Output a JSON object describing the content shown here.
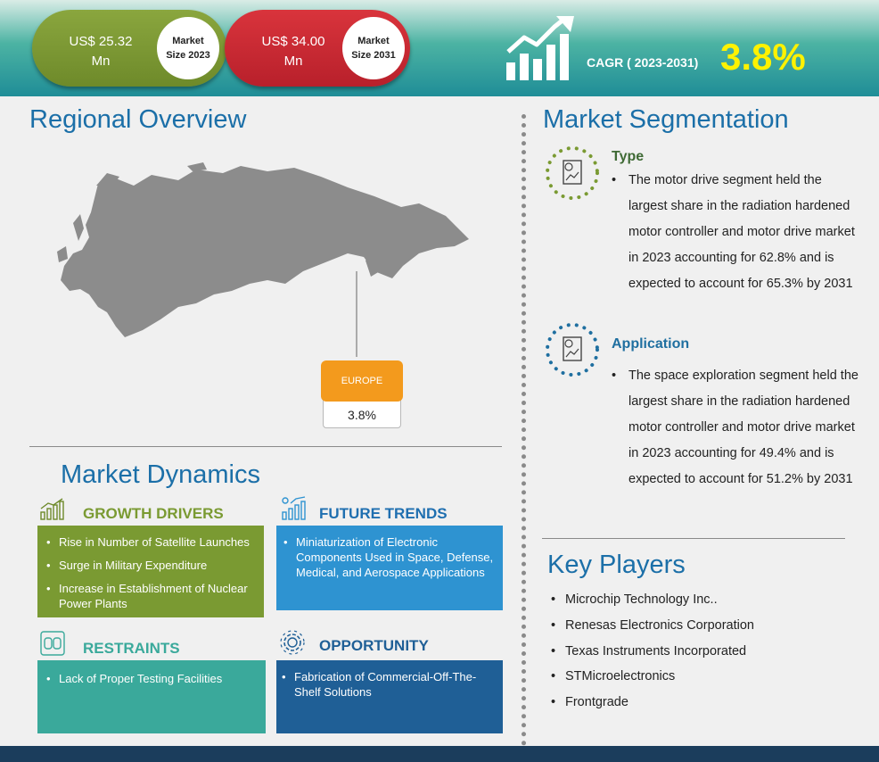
{
  "header": {
    "market_2023": {
      "value_line1": "US$ 25.32",
      "value_line2": "Mn",
      "label_line1": "Market",
      "label_line2": "Size 2023"
    },
    "market_2031": {
      "value_line1": "US$ 34.00",
      "value_line2": "Mn",
      "label_line1": "Market",
      "label_line2": "Size 2031"
    },
    "cagr_label": "CAGR ( 2023-2031)",
    "cagr_value": "3.8%",
    "colors": {
      "green": "#7a9a32",
      "red": "#c42a33",
      "teal": "#2e9c9c",
      "highlight": "#fff200"
    }
  },
  "regional": {
    "title": "Regional Overview",
    "region_name": "EUROPE",
    "region_value": "3.8%"
  },
  "dynamics": {
    "title": "Market Dynamics",
    "growth_drivers": {
      "title": "GROWTH DRIVERS",
      "icon": "bar-chart-icon",
      "items": [
        "Rise in Number of Satellite Launches",
        "Surge in Military Expenditure",
        "Increase in Establishment of Nuclear Power Plants"
      ],
      "color": "#7a9a32"
    },
    "future_trends": {
      "title": "FUTURE TRENDS",
      "icon": "trend-chart-icon",
      "items": [
        "Miniaturization of Electronic Components Used in Space, Defense, Medical, and Aerospace Applications"
      ],
      "color": "#2e93d1"
    },
    "restraints": {
      "title": "RESTRAINTS",
      "icon": "broken-chain-icon",
      "items": [
        "Lack of Proper Testing Facilities"
      ],
      "color": "#3aa99b"
    },
    "opportunity": {
      "title": "OPPORTUNITY",
      "icon": "gear-icon",
      "items": [
        "Fabrication of Commercial-Off-The-Shelf Solutions"
      ],
      "color": "#1f5f96"
    }
  },
  "segmentation": {
    "title": "Market Segmentation",
    "type": {
      "title": "Type",
      "text": "The motor drive segment held the largest share in the radiation hardened motor controller and motor drive market in 2023 accounting for 62.8% and is expected to account for 65.3% by 2031",
      "icon": "report-chart-icon"
    },
    "application": {
      "title": "Application",
      "text": "The space exploration segment held the largest share in the radiation hardened motor controller and motor drive market in 2023 accounting for 49.4% and is expected to account for 51.2% by 2031",
      "icon": "report-chart-icon"
    }
  },
  "key_players": {
    "title": "Key Players",
    "items": [
      "Microchip Technology Inc..",
      "Renesas Electronics Corporation",
      "Texas Instruments Incorporated",
      "STMicroelectronics",
      "Frontgrade"
    ]
  }
}
